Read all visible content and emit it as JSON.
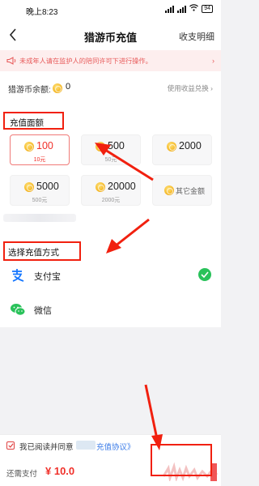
{
  "status_bar": {
    "time": "晚上8:23",
    "battery": "94"
  },
  "nav": {
    "title": "猎游币充值",
    "right_link": "收支明细"
  },
  "warning": {
    "text": "未成年人请在监护人的陪同许可下进行操作。"
  },
  "balance": {
    "label": "猎游币余额:",
    "value": "0",
    "link": "使用收益兑换 ›"
  },
  "recharge": {
    "title": "充值面额",
    "options": [
      {
        "amount": "100",
        "price": "10元",
        "selected": true
      },
      {
        "amount": "500",
        "price": "50元",
        "selected": false
      },
      {
        "amount": "2000",
        "price": "",
        "selected": false
      },
      {
        "amount": "5000",
        "price": "500元",
        "selected": false
      },
      {
        "amount": "20000",
        "price": "2000元",
        "selected": false
      }
    ],
    "other_label": "其它金额"
  },
  "payment": {
    "title": "选择充值方式",
    "methods": [
      {
        "label": "支付宝",
        "icon": "alipay-icon",
        "selected": true
      },
      {
        "label": "微信",
        "icon": "wechat-icon",
        "selected": false
      }
    ]
  },
  "agreement": {
    "text": "我已阅读并同意",
    "link": "充值协议》"
  },
  "footer": {
    "due_label": "还需支付",
    "due_amount": "¥ 10.0"
  },
  "colors": {
    "accent_red": "#f0302a",
    "alipay_blue": "#1677ff",
    "wechat_green": "#29c25a",
    "annotation_red": "#f1200f"
  }
}
